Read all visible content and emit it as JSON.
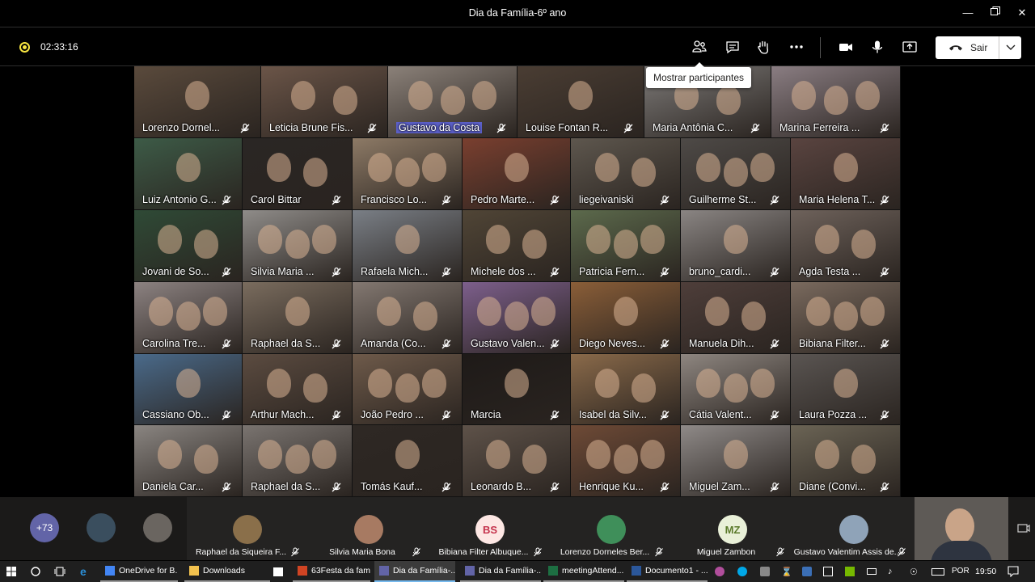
{
  "window": {
    "title": "Dia da Família-6º ano"
  },
  "toolbar": {
    "timer": "02:33:16",
    "leave_label": "Sair",
    "tooltip": "Mostrar participantes"
  },
  "grid": {
    "tiles": [
      {
        "name": "Lorenzo Dornel...",
        "bg": "#5a4a3c",
        "active": false
      },
      {
        "name": "Leticia Brune Fis...",
        "bg": "#6b5548",
        "active": false
      },
      {
        "name": "Gustavo da Costa",
        "bg": "#8b8179",
        "active": true
      },
      {
        "name": "Louise Fontan R...",
        "bg": "#4a3d33",
        "active": false
      },
      {
        "name": "Maria Antônia C...",
        "bg": "#7d7a78",
        "active": false
      },
      {
        "name": "Marina Ferreira ...",
        "bg": "#8a7d82",
        "active": false
      },
      {
        "name": "Luiz Antonio G...",
        "bg": "#3d5b47",
        "active": false
      },
      {
        "name": "Carol Bittar",
        "bg": "#2a2624",
        "active": false
      },
      {
        "name": "Francisco Lo...",
        "bg": "#8d7a66",
        "active": false
      },
      {
        "name": "Pedro Marte...",
        "bg": "#7a3f2f",
        "active": false
      },
      {
        "name": "liegeivaniski",
        "bg": "#5e574e",
        "active": false
      },
      {
        "name": "Guilherme St...",
        "bg": "#4e4a47",
        "active": false
      },
      {
        "name": "Maria Helena T...",
        "bg": "#5a4440",
        "active": false
      },
      {
        "name": "Jovani de So...",
        "bg": "#2f4a36",
        "active": false
      },
      {
        "name": "Silvia Maria ...",
        "bg": "#8f8c89",
        "active": false
      },
      {
        "name": "Rafaela Mich...",
        "bg": "#7a7f86",
        "active": false
      },
      {
        "name": "Michele dos ...",
        "bg": "#504536",
        "active": false
      },
      {
        "name": "Patricia Fern...",
        "bg": "#5c6a4c",
        "active": false
      },
      {
        "name": "bruno_cardi...",
        "bg": "#8a8583",
        "active": false
      },
      {
        "name": "Agda Testa ...",
        "bg": "#6e625b",
        "active": false
      },
      {
        "name": "Carolina Tre...",
        "bg": "#8c8281",
        "active": false
      },
      {
        "name": "Raphael da S...",
        "bg": "#7a6c5e",
        "active": false
      },
      {
        "name": "Amanda (Co...",
        "bg": "#837871",
        "active": false
      },
      {
        "name": "Gustavo Valen...",
        "bg": "#7d5f8c",
        "active": false
      },
      {
        "name": "Diego Neves...",
        "bg": "#8a5e38",
        "active": false
      },
      {
        "name": "Manuela Dih...",
        "bg": "#4e3e3a",
        "active": false
      },
      {
        "name": "Bibiana Filter...",
        "bg": "#7a6a5e",
        "active": false
      },
      {
        "name": "Cassiano Ob...",
        "bg": "#4a6a8a",
        "active": false
      },
      {
        "name": "Arthur Mach...",
        "bg": "#5b4b40",
        "active": false
      },
      {
        "name": "João Pedro ...",
        "bg": "#6e5a4a",
        "active": false
      },
      {
        "name": "Marcia",
        "bg": "#1e1a18",
        "active": false
      },
      {
        "name": "Isabel da Silv...",
        "bg": "#8a6a4a",
        "active": false
      },
      {
        "name": "Cátia Valent...",
        "bg": "#8e8680",
        "active": false
      },
      {
        "name": "Laura Pozza ...",
        "bg": "#5a5552",
        "active": false
      },
      {
        "name": "Daniela Car...",
        "bg": "#8a8581",
        "active": false
      },
      {
        "name": "Raphael da S...",
        "bg": "#7a7470",
        "active": false
      },
      {
        "name": "Tomás Kauf...",
        "bg": "#2e2824",
        "active": false
      },
      {
        "name": "Leonardo B...",
        "bg": "#5e5249",
        "active": false
      },
      {
        "name": "Henrique Ku...",
        "bg": "#6e4a36",
        "active": false
      },
      {
        "name": "Miguel Zam...",
        "bg": "#8f8a88",
        "active": false
      },
      {
        "name": "Diane (Convi...",
        "bg": "#6b6455",
        "active": false
      }
    ]
  },
  "strip": {
    "overflow_count": "+73",
    "participants": [
      {
        "name": "Raphael da Siqueira F...",
        "initials": "",
        "avatar_bg": "#8a6f4a",
        "avatar_fg": "#ffffff"
      },
      {
        "name": "Silvia Maria Bona",
        "initials": "",
        "avatar_bg": "#a77a62",
        "avatar_fg": "#ffffff"
      },
      {
        "name": "Bibiana Filter Albuque...",
        "initials": "BS",
        "avatar_bg": "#fde7e4",
        "avatar_fg": "#c4314b"
      },
      {
        "name": "Lorenzo Dorneles Ber...",
        "initials": "",
        "avatar_bg": "#3f8f5a",
        "avatar_fg": "#ffffff"
      },
      {
        "name": "Miguel Zambon",
        "initials": "MZ",
        "avatar_bg": "#e9f0d8",
        "avatar_fg": "#5b7a2b"
      },
      {
        "name": "Gustavo Valentim Assis de...",
        "initials": "",
        "avatar_bg": "#8fa3b8",
        "avatar_fg": "#ffffff"
      }
    ]
  },
  "taskbar": {
    "items": [
      {
        "label": "OneDrive for B...",
        "icon_color": "#4285f4",
        "state": "open"
      },
      {
        "label": "Downloads",
        "icon_color": "#f2c14e",
        "state": "open"
      },
      {
        "label": "63Festa da fam...",
        "icon_color": "#d04423",
        "state": "open"
      },
      {
        "label": "Dia da Família-...",
        "icon_color": "#6264a7",
        "state": "active"
      },
      {
        "label": "Dia da Família-...",
        "icon_color": "#6264a7",
        "state": "open"
      },
      {
        "label": "meetingAttend...",
        "icon_color": "#1d6f42",
        "state": "open"
      },
      {
        "label": "Documento1 - ...",
        "icon_color": "#2b579a",
        "state": "open"
      }
    ],
    "lang": "POR",
    "time": "19:50"
  }
}
